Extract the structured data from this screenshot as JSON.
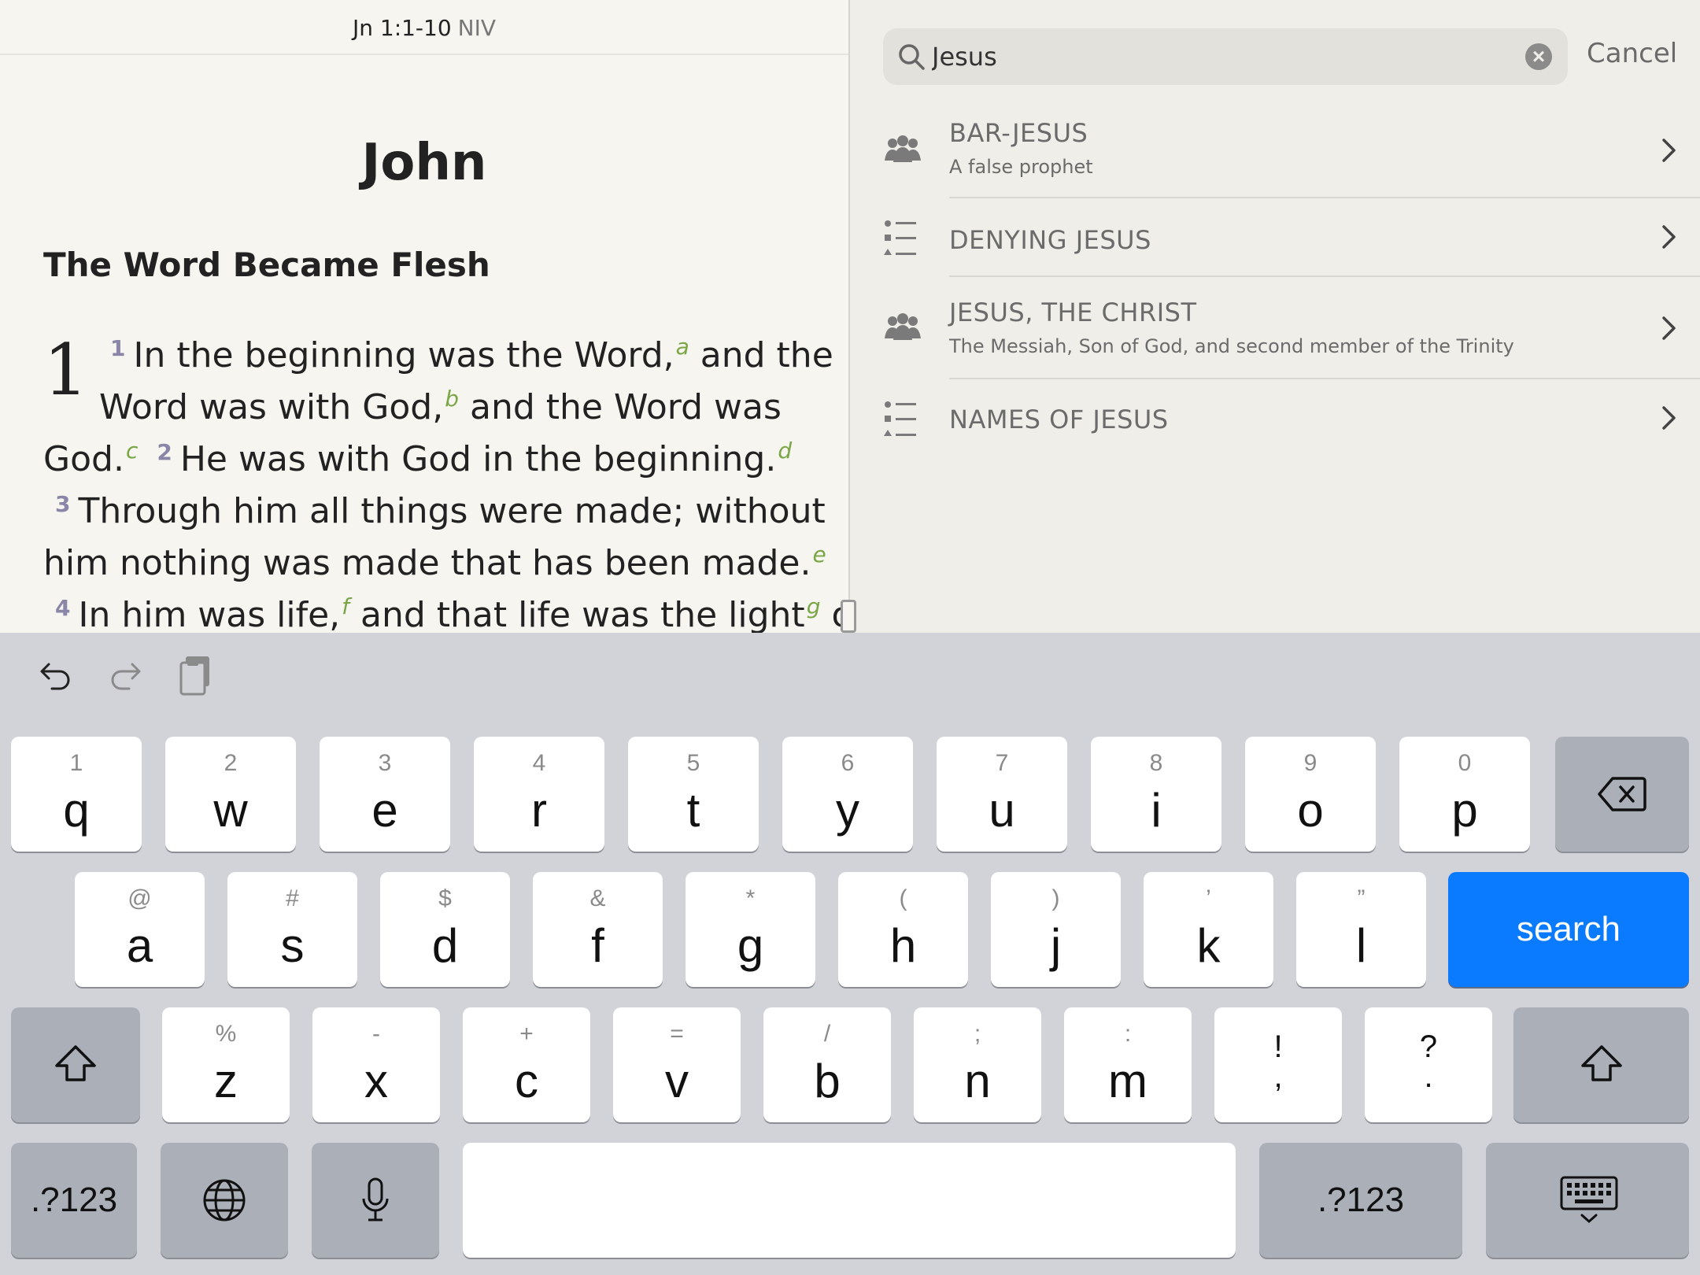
{
  "reader": {
    "reference": "Jn 1:1-10",
    "version": "NIV",
    "book_title": "John",
    "section_heading": "The Word Became Flesh",
    "chapter_number": "1",
    "lines": [
      {
        "v": "1",
        "segs": [
          {
            "t": "In the beginning was the Word,"
          },
          {
            "fn": "a"
          },
          {
            "t": " and the"
          }
        ]
      },
      {
        "segs": [
          {
            "t": "Word was with God,"
          },
          {
            "fn": "b"
          },
          {
            "t": " and the Word was"
          }
        ]
      },
      {
        "segs": [
          {
            "t": "God."
          },
          {
            "fn": "c"
          },
          {
            "v": "2"
          },
          {
            "t": "He was with God in the beginning."
          },
          {
            "fn": "d"
          }
        ]
      },
      {
        "v": "3",
        "segs": [
          {
            "t": "Through him all things were made; without"
          }
        ]
      },
      {
        "segs": [
          {
            "t": "him nothing was made that has been made."
          },
          {
            "fn": "e"
          }
        ]
      },
      {
        "v": "4",
        "segs": [
          {
            "t": "In him was life,"
          },
          {
            "fn": "f"
          },
          {
            "t": " and that life was the light"
          },
          {
            "fn": "g"
          },
          {
            "t": " of"
          }
        ]
      }
    ]
  },
  "search": {
    "query": "Jesus",
    "cancel_label": "Cancel",
    "results": [
      {
        "icon": "people-icon",
        "title": "BAR-JESUS",
        "subtitle": "A false prophet"
      },
      {
        "icon": "list-icon",
        "title": "DENYING JESUS",
        "subtitle": ""
      },
      {
        "icon": "people-icon",
        "title": "JESUS, THE CHRIST",
        "subtitle": "The Messiah, Son of God, and second member of the Trinity"
      },
      {
        "icon": "list-icon",
        "title": "NAMES OF JESUS",
        "subtitle": ""
      }
    ]
  },
  "keyboard": {
    "tools": [
      "undo-icon",
      "redo-icon",
      "paste-icon"
    ],
    "row1": [
      {
        "k": "q",
        "a": "1"
      },
      {
        "k": "w",
        "a": "2"
      },
      {
        "k": "e",
        "a": "3"
      },
      {
        "k": "r",
        "a": "4"
      },
      {
        "k": "t",
        "a": "5"
      },
      {
        "k": "y",
        "a": "6"
      },
      {
        "k": "u",
        "a": "7"
      },
      {
        "k": "i",
        "a": "8"
      },
      {
        "k": "o",
        "a": "9"
      },
      {
        "k": "p",
        "a": "0"
      }
    ],
    "row2": [
      {
        "k": "a",
        "a": "@"
      },
      {
        "k": "s",
        "a": "#"
      },
      {
        "k": "d",
        "a": "$"
      },
      {
        "k": "f",
        "a": "&"
      },
      {
        "k": "g",
        "a": "*"
      },
      {
        "k": "h",
        "a": "("
      },
      {
        "k": "j",
        "a": ")"
      },
      {
        "k": "k",
        "a": "’"
      },
      {
        "k": "l",
        "a": "”"
      }
    ],
    "row3": [
      {
        "k": "z",
        "a": "%"
      },
      {
        "k": "x",
        "a": "-"
      },
      {
        "k": "c",
        "a": "+"
      },
      {
        "k": "v",
        "a": "="
      },
      {
        "k": "b",
        "a": "/"
      },
      {
        "k": "n",
        "a": ";"
      },
      {
        "k": "m",
        "a": ":"
      }
    ],
    "punct_keys": [
      {
        "top": "!",
        "bottom": ","
      },
      {
        "top": "?",
        "bottom": "."
      }
    ],
    "search_label": "search",
    "numbers_label": ".?123"
  }
}
